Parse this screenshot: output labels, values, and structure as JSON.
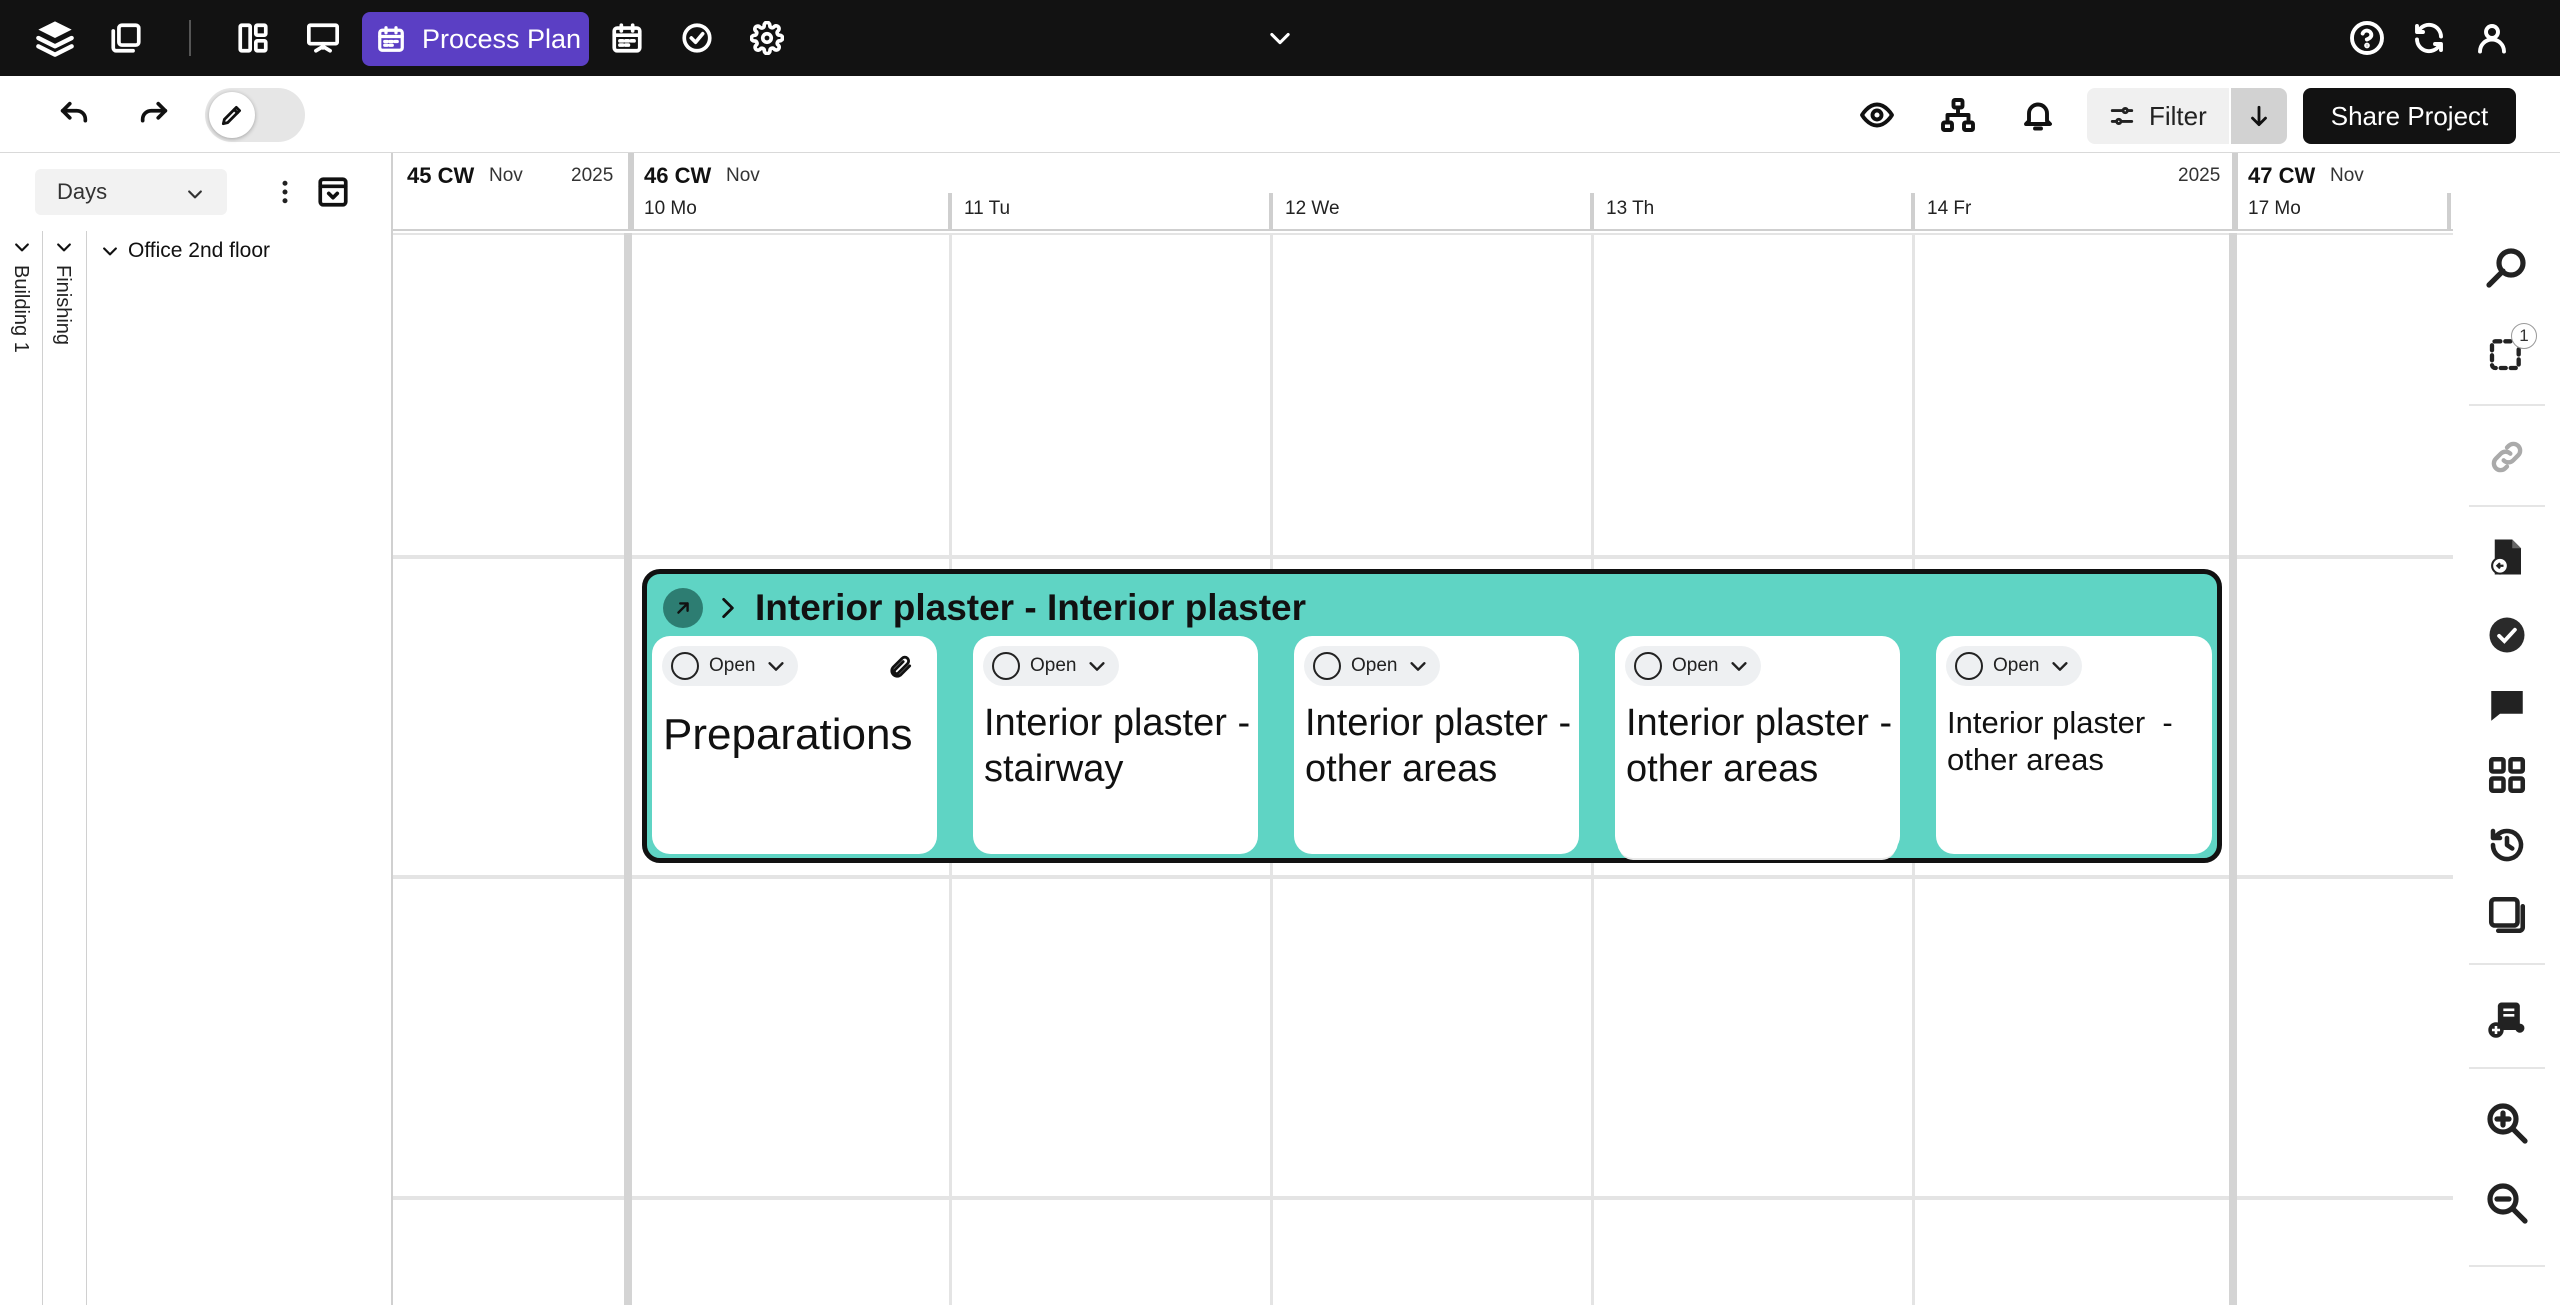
{
  "app": {
    "active_module": "Process Plan"
  },
  "toolbar": {
    "filter_label": "Filter",
    "share_label": "Share Project"
  },
  "left_panel": {
    "view_select": "Days",
    "tree": {
      "level1": "Building 1",
      "level2": "Finishing",
      "level3": "Office 2nd floor"
    }
  },
  "timeline": {
    "weeks": [
      {
        "week": "45 CW",
        "month": "Nov",
        "year": "2025"
      },
      {
        "week": "46 CW",
        "month": "Nov",
        "year": "2025"
      },
      {
        "week": "47 CW",
        "month": "Nov"
      }
    ],
    "days": [
      "10 Mo",
      "11 Tu",
      "12 We",
      "13 Th",
      "14 Fr",
      "17 Mo"
    ]
  },
  "task_group": {
    "title": "Interior plaster - Interior plaster",
    "cards": [
      {
        "status": "Open",
        "title": "Preparations",
        "has_attachment": true
      },
      {
        "status": "Open",
        "title": "Interior plaster - stairway"
      },
      {
        "status": "Open",
        "title": "Interior plaster - other areas"
      },
      {
        "status": "Open",
        "title": "Interior plaster - other areas"
      },
      {
        "status": "Open",
        "title": "Interior plaster  - other areas"
      }
    ]
  },
  "right_sidebar": {
    "selection_count": "1"
  },
  "icons": {
    "top": [
      "layers-icon",
      "copy-icon",
      "dashboard-icon",
      "presentation-icon",
      "calendar-icon",
      "calendar-icon",
      "check-circle-icon",
      "gear-icon",
      "chevron-down-icon",
      "help-icon",
      "refresh-icon",
      "user-icon"
    ],
    "toolbar": [
      "undo-icon",
      "redo-icon",
      "pencil-icon",
      "eye-icon",
      "hierarchy-icon",
      "bell-icon",
      "sliders-icon",
      "arrow-down-icon"
    ],
    "right": [
      "search-icon",
      "selection-icon",
      "link-icon",
      "document-import-icon",
      "check-filled-icon",
      "comment-icon",
      "grid-icon",
      "history-icon",
      "layers-window-icon",
      "add-document-icon",
      "zoom-in-icon",
      "zoom-out-icon"
    ]
  },
  "colors": {
    "accent": "#5b3fc4",
    "task_group": "#5fd4c4",
    "topbar": "#121212"
  }
}
